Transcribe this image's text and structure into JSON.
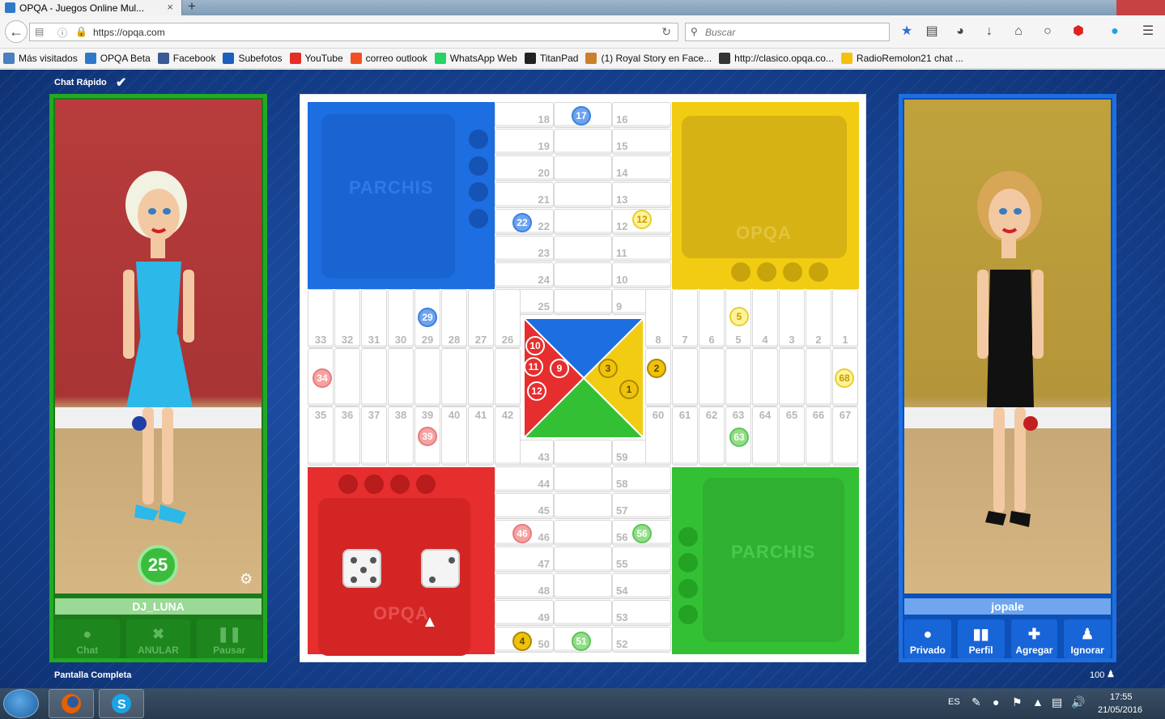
{
  "browser": {
    "tab_title": "OPQA - Juegos Online Mul...",
    "tab_close": "×",
    "new_tab": "+",
    "url": "https://opqa.com",
    "search_placeholder": "Buscar",
    "toolbar_icons": [
      "bookmark-star-icon",
      "reading-list-icon",
      "pocket-icon",
      "download-icon",
      "home-icon",
      "chat-icon",
      "adblock-icon",
      "skype-icon",
      "menu-icon"
    ],
    "bookmarks": [
      {
        "label": "Más visitados",
        "icon": "most-visited-icon",
        "color": "#4a7fc0"
      },
      {
        "label": "OPQA Beta",
        "icon": "opqa-icon",
        "color": "#2f78c8"
      },
      {
        "label": "Facebook",
        "icon": "facebook-icon",
        "color": "#3b5998"
      },
      {
        "label": "Subefotos",
        "icon": "subefotos-icon",
        "color": "#1c5fbf"
      },
      {
        "label": "YouTube",
        "icon": "youtube-icon",
        "color": "#e52d27"
      },
      {
        "label": "correo outlook",
        "icon": "windows-icon",
        "color": "#f25022"
      },
      {
        "label": "WhatsApp Web",
        "icon": "whatsapp-icon",
        "color": "#25d366"
      },
      {
        "label": "TitanPad",
        "icon": "titanpad-icon",
        "color": "#222222"
      },
      {
        "label": "(1) Royal Story en Face...",
        "icon": "royal-story-icon",
        "color": "#c9822b"
      },
      {
        "label": "http://clasico.opqa.co...",
        "icon": "clasico-icon",
        "color": "#333333"
      },
      {
        "label": "RadioRemolon21 chat ...",
        "icon": "smiley-icon",
        "color": "#f4c20d"
      }
    ]
  },
  "game": {
    "chat_rapido": "Chat Rápido",
    "pantalla_completa": "Pantalla Completa",
    "online_count": "100",
    "left_player": {
      "name": "DJ_LUNA",
      "timer": "25",
      "buttons": [
        "Chat",
        "ANULAR",
        "Pausar"
      ]
    },
    "right_player": {
      "name": "jopale",
      "buttons": [
        "Privado",
        "Perfil",
        "Agregar",
        "Ignorar"
      ]
    },
    "board": {
      "colors": {
        "blue": "#1d6ee0",
        "red": "#e62e2e",
        "yellow": "#f2cc12",
        "green": "#34c034"
      },
      "logo_parchis": "PARCHIS",
      "logo_opqa": "OPQA",
      "dice": [
        5,
        2
      ],
      "pieces": [
        {
          "label": "17",
          "color": "blue"
        },
        {
          "label": "22",
          "color": "blue"
        },
        {
          "label": "29",
          "color": "blue"
        },
        {
          "label": "12",
          "color": "yellow"
        },
        {
          "label": "5",
          "color": "yellow"
        },
        {
          "label": "68",
          "color": "yellow"
        },
        {
          "label": "34",
          "color": "red"
        },
        {
          "label": "39",
          "color": "red"
        },
        {
          "label": "46",
          "color": "red"
        },
        {
          "label": "63",
          "color": "green"
        },
        {
          "label": "56",
          "color": "green"
        },
        {
          "label": "51",
          "color": "green"
        },
        {
          "label": "4",
          "color": "gold"
        },
        {
          "label": "10",
          "color": "red-home"
        },
        {
          "label": "11",
          "color": "red-home"
        },
        {
          "label": "9",
          "color": "red-home"
        },
        {
          "label": "12",
          "color": "red-home"
        },
        {
          "label": "3",
          "color": "gold"
        },
        {
          "label": "2",
          "color": "gold"
        },
        {
          "label": "1",
          "color": "gold"
        }
      ]
    }
  },
  "taskbar": {
    "language": "ES",
    "time": "17:55",
    "date": "21/05/2016"
  }
}
